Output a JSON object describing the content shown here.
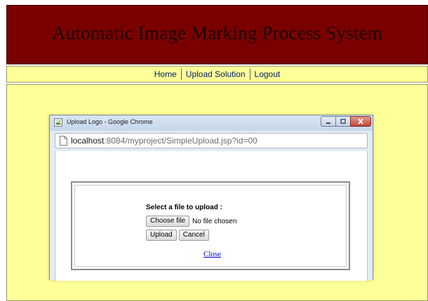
{
  "header": {
    "title": "Automatic Image Marking Process System"
  },
  "nav": {
    "items": [
      {
        "label": "Home"
      },
      {
        "label": "Upload Solution"
      },
      {
        "label": "Logout"
      }
    ]
  },
  "popup": {
    "window_title": "Upload Logo - Google Chrome",
    "url_host": "localhost",
    "url_rest": ":8084/myproject/SimpleUpload.jsp?id=00",
    "form": {
      "heading": "Select a file to upload :",
      "choose_file_label": "Choose file",
      "file_status": "No file chosen",
      "upload_label": "Upload",
      "cancel_label": "Cancel",
      "close_link": "Close"
    }
  },
  "colors": {
    "banner": "#7a0000",
    "page_background": "#ffff99",
    "link": "#0000cc"
  },
  "icons": [
    "app-icon",
    "page-icon",
    "minimize-icon",
    "maximize-icon",
    "close-icon"
  ]
}
